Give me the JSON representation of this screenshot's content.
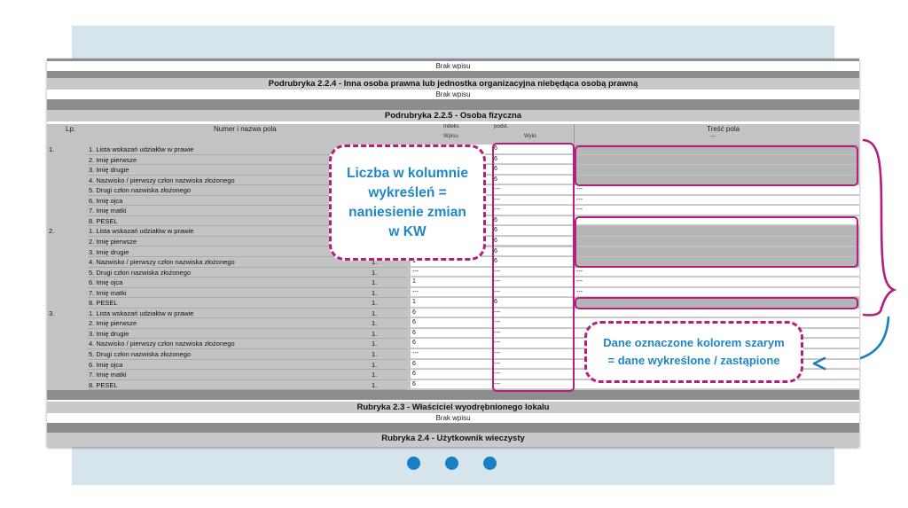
{
  "sections": {
    "top_brak": "Brak wpisu",
    "s224_title": "Podrubryka 2.2.4 - Inna osoba prawna lub jednostka organizacyjna niebędąca osobą prawną",
    "s224_brak": "Brak wpisu",
    "s225_title": "Podrubryka 2.2.5 - Osoba fizyczna",
    "s23_title": "Rubryka 2.3 - Właściciel wyodrębnionego lokalu",
    "s23_brak": "Brak wpisu",
    "s24_title": "Rubryka 2.4 - Użytkownik wieczysty"
  },
  "table": {
    "headers": {
      "lp": "Lp.",
      "name": "Numer i nazwa pola",
      "indeks": "Indeks",
      "wpisu": "Wpisu",
      "podst": "podst.",
      "wykr": "Wykr.",
      "tresc": "Treść pola",
      "tresc_sub": "---"
    },
    "persons": [
      {
        "lp": "1.",
        "rows": [
          {
            "name": "1. Lista wskazań udziałów w prawie",
            "ix": "",
            "wp": "",
            "wy": "6",
            "tr": "",
            "grey": true
          },
          {
            "name": "2. Imię pierwsze",
            "ix": "",
            "wp": "",
            "wy": "6",
            "tr": "",
            "grey": true
          },
          {
            "name": "3. Imię drugie",
            "ix": "",
            "wp": "",
            "wy": "6",
            "tr": "",
            "grey": true
          },
          {
            "name": "4. Nazwisko / pierwszy człon nazwiska złożonego",
            "ix": "",
            "wp": "",
            "wy": "6",
            "tr": "",
            "grey": true
          },
          {
            "name": "5. Drugi człon nazwiska złożonego",
            "ix": "",
            "wp": "",
            "wy": "---",
            "tr": "---",
            "grey": false
          },
          {
            "name": "6. Imię ojca",
            "ix": "",
            "wp": "",
            "wy": "---",
            "tr": "---",
            "grey": false
          },
          {
            "name": "7. Imię matki",
            "ix": "",
            "wp": "",
            "wy": "---",
            "tr": "---",
            "grey": false
          },
          {
            "name": "8. PESEL",
            "ix": "",
            "wp": "",
            "wy": "6",
            "tr": "",
            "grey": false
          }
        ]
      },
      {
        "lp": "2.",
        "rows": [
          {
            "name": "1. Lista wskazań udziałów w prawie",
            "ix": "",
            "wp": "",
            "wy": "6",
            "tr": "",
            "grey": true
          },
          {
            "name": "2. Imię pierwsze",
            "ix": "",
            "wp": "",
            "wy": "6",
            "tr": "",
            "grey": true
          },
          {
            "name": "3. Imię drugie",
            "ix": "",
            "wp": "",
            "wy": "6",
            "tr": "",
            "grey": true
          },
          {
            "name": "4. Nazwisko / pierwszy człon nazwiska złożonego",
            "ix": "1.",
            "wp": "1",
            "wy": "6",
            "tr": "",
            "grey": true
          },
          {
            "name": "5. Drugi człon nazwiska złożonego",
            "ix": "1.",
            "wp": "---",
            "wy": "---",
            "tr": "---",
            "grey": false
          },
          {
            "name": "6. Imię ojca",
            "ix": "1.",
            "wp": "1",
            "wy": "---",
            "tr": "---",
            "grey": false
          },
          {
            "name": "7. Imię matki",
            "ix": "1.",
            "wp": "---",
            "wy": "---",
            "tr": "---",
            "grey": false
          },
          {
            "name": "8. PESEL",
            "ix": "1.",
            "wp": "1",
            "wy": "6",
            "tr": "",
            "grey": true
          }
        ]
      },
      {
        "lp": "3.",
        "rows": [
          {
            "name": "1. Lista wskazań udziałów w prawie",
            "ix": "1.",
            "wp": "6",
            "wy": "---",
            "tr": "",
            "grey": false
          },
          {
            "name": "2. Imię pierwsze",
            "ix": "1.",
            "wp": "6",
            "wy": "---",
            "tr": "",
            "grey": false
          },
          {
            "name": "3. Imię drugie",
            "ix": "1.",
            "wp": "6",
            "wy": "---",
            "tr": "",
            "grey": false
          },
          {
            "name": "4. Nazwisko / pierwszy człon nazwiska złożonego",
            "ix": "1.",
            "wp": "6",
            "wy": "---",
            "tr": "",
            "grey": false
          },
          {
            "name": "5. Drugi człon nazwiska złożonego",
            "ix": "1.",
            "wp": "---",
            "wy": "---",
            "tr": "",
            "grey": false
          },
          {
            "name": "6. Imię ojca",
            "ix": "1.",
            "wp": "6",
            "wy": "---",
            "tr": "",
            "grey": false
          },
          {
            "name": "7. Imię matki",
            "ix": "1.",
            "wp": "6",
            "wy": "---",
            "tr": "",
            "grey": false
          },
          {
            "name": "8. PESEL",
            "ix": "1.",
            "wp": "6",
            "wy": "---",
            "tr": "",
            "grey": false
          }
        ]
      }
    ]
  },
  "callouts": {
    "left": "Liczba w kolumnie wykreśleń = naniesienie zmian w KW",
    "right": "Dane oznaczone kolorem szarym = dane wykreślone / zastąpione"
  },
  "colors": {
    "magenta": "#b51d7e",
    "blue_text": "#1f86c7",
    "dot_blue": "#1a7ec5",
    "frame": "#d6e5ec"
  },
  "pagination": {
    "dots": 3,
    "icon": "dot-icon"
  }
}
